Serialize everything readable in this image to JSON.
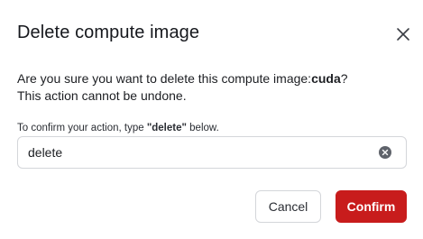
{
  "dialog": {
    "title": "Delete compute image",
    "close_icon": "close-icon",
    "message_prefix": "Are you sure you want to delete this compute image:",
    "image_name": "cuda",
    "message_suffix": "?",
    "message_line2": "This action cannot be undone.",
    "confirm_prompt_prefix": "To confirm your action, type ",
    "confirm_keyword": "\"delete\"",
    "confirm_prompt_suffix": " below.",
    "input": {
      "value": "delete",
      "clear_icon": "clear-circle-icon"
    },
    "buttons": {
      "cancel_label": "Cancel",
      "confirm_label": "Confirm"
    },
    "colors": {
      "danger": "#c81c1c",
      "border": "#d4d6da",
      "text": "#16181d"
    }
  }
}
